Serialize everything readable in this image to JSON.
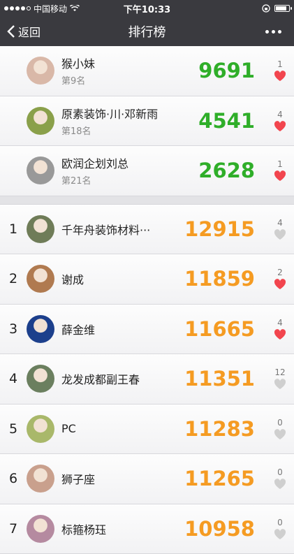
{
  "status": {
    "carrier": "中国移动",
    "time": "下午10:33"
  },
  "nav": {
    "back_label": "返回",
    "title": "排行榜"
  },
  "friends": [
    {
      "name": "猴小妹",
      "sub": "第9名",
      "score": "9691",
      "likes": "1",
      "liked": true,
      "avatar_bg": "#d9b8a8"
    },
    {
      "name": "原素装饰·川·邓新雨",
      "sub": "第18名",
      "score": "4541",
      "likes": "4",
      "liked": true,
      "avatar_bg": "#8aa04a"
    },
    {
      "name": "欧润企划刘总",
      "sub": "第21名",
      "score": "2628",
      "likes": "1",
      "liked": true,
      "avatar_bg": "#999"
    }
  ],
  "ranking": [
    {
      "rank": "1",
      "name": "千年舟装饰材料···",
      "score": "12915",
      "likes": "4",
      "liked": false,
      "avatar_bg": "#6f7c58"
    },
    {
      "rank": "2",
      "name": "谢成",
      "score": "11859",
      "likes": "2",
      "liked": true,
      "avatar_bg": "#b07a50"
    },
    {
      "rank": "3",
      "name": "薛金维",
      "score": "11665",
      "likes": "4",
      "liked": true,
      "avatar_bg": "#1c3f8c"
    },
    {
      "rank": "4",
      "name": "龙发成都副王春",
      "score": "11351",
      "likes": "12",
      "liked": false,
      "avatar_bg": "#6b7f5f"
    },
    {
      "rank": "5",
      "name": "PC",
      "score": "11283",
      "likes": "0",
      "liked": false,
      "avatar_bg": "#a9b86a"
    },
    {
      "rank": "6",
      "name": "狮子座",
      "score": "11265",
      "likes": "0",
      "liked": false,
      "avatar_bg": "#c9a08d"
    },
    {
      "rank": "7",
      "name": "标箍杨珏",
      "score": "10958",
      "likes": "0",
      "liked": false,
      "avatar_bg": "#b58aa0"
    }
  ],
  "colors": {
    "friend_score": "#2fae29",
    "rank_score": "#f59b22",
    "heart_on": "#f2454e",
    "heart_off": "#cfcfcf"
  }
}
